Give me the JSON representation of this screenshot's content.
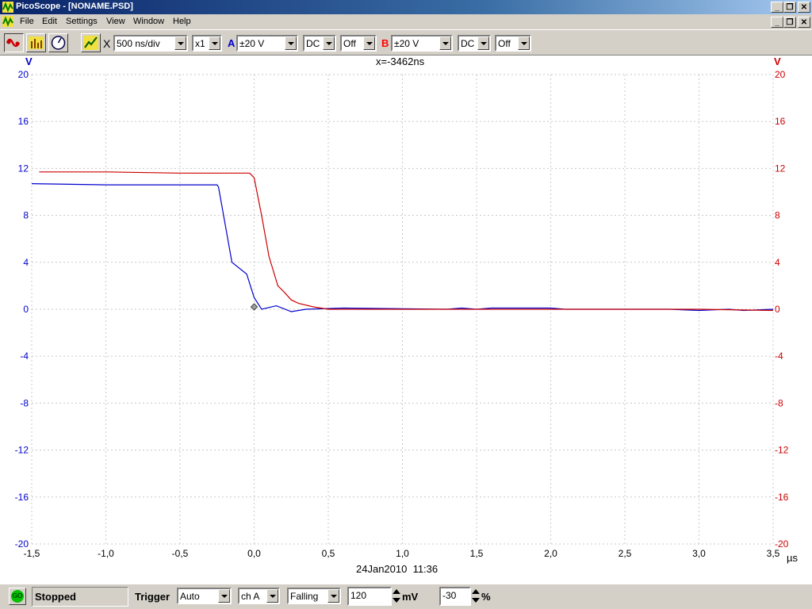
{
  "window": {
    "title": "PicoScope - [NONAME.PSD]"
  },
  "menu": [
    "File",
    "Edit",
    "Settings",
    "View",
    "Window",
    "Help"
  ],
  "toolbar": {
    "x_symbol": "X",
    "timebase": "500 ns/div",
    "zoom": "x1",
    "channel_a": {
      "label": "A",
      "range": "±20 V",
      "coupling": "DC",
      "extra": "Off",
      "color": "#0000cc"
    },
    "channel_b": {
      "label": "B",
      "range": "±20 V",
      "coupling": "DC",
      "extra": "Off",
      "color": "#ff0000"
    }
  },
  "plot": {
    "cursor_readout": "x=-3462ns",
    "y_unit_left": "V",
    "y_unit_right": "V",
    "x_unit": "µs",
    "timestamp": "24Jan2010  11:36",
    "x_ticks": [
      "-1,5",
      "-1,0",
      "-0,5",
      "0,0",
      "0,5",
      "1,0",
      "1,5",
      "2,0",
      "2,5",
      "3,0",
      "3,5"
    ],
    "y_ticks": [
      "20",
      "16",
      "12",
      "8",
      "4",
      "0",
      "-4",
      "-8",
      "-12",
      "-16",
      "-20"
    ]
  },
  "chart_data": {
    "type": "line",
    "xlim": [
      -1.5,
      3.5
    ],
    "ylim": [
      -20,
      20
    ],
    "grid": true,
    "trigger_marker": {
      "x": 0.0,
      "y": 0.2
    },
    "series": [
      {
        "channel": "A",
        "color": "#0000cc",
        "points": [
          [
            -1.5,
            10.7
          ],
          [
            -1.0,
            10.6
          ],
          [
            -0.5,
            10.6
          ],
          [
            -0.25,
            10.6
          ],
          [
            -0.24,
            10.4
          ],
          [
            -0.15,
            4.0
          ],
          [
            -0.05,
            3.0
          ],
          [
            0.0,
            1.0
          ],
          [
            0.05,
            0.0
          ],
          [
            0.15,
            0.3
          ],
          [
            0.25,
            -0.2
          ],
          [
            0.35,
            0.0
          ],
          [
            0.6,
            0.1
          ],
          [
            1.3,
            0.0
          ],
          [
            1.4,
            0.1
          ],
          [
            1.5,
            0.0
          ],
          [
            1.6,
            0.1
          ],
          [
            2.0,
            0.1
          ],
          [
            2.1,
            0.0
          ],
          [
            2.8,
            0.0
          ],
          [
            3.0,
            -0.1
          ],
          [
            3.2,
            0.0
          ],
          [
            3.3,
            -0.1
          ],
          [
            3.5,
            0.0
          ]
        ]
      },
      {
        "channel": "B",
        "color": "#cc0000",
        "points": [
          [
            -1.45,
            11.7
          ],
          [
            -1.0,
            11.7
          ],
          [
            -0.5,
            11.6
          ],
          [
            -0.03,
            11.6
          ],
          [
            0.0,
            11.2
          ],
          [
            0.05,
            8.0
          ],
          [
            0.1,
            4.5
          ],
          [
            0.16,
            2.0
          ],
          [
            0.2,
            1.5
          ],
          [
            0.25,
            0.8
          ],
          [
            0.3,
            0.5
          ],
          [
            0.4,
            0.2
          ],
          [
            0.5,
            0.0
          ],
          [
            1.0,
            0.0
          ],
          [
            2.0,
            0.0
          ],
          [
            3.0,
            0.0
          ],
          [
            3.5,
            -0.1
          ]
        ]
      }
    ]
  },
  "status": {
    "go_label": "GO",
    "state": "Stopped",
    "trigger_label": "Trigger",
    "trigger_mode": "Auto",
    "trigger_channel": "ch A",
    "trigger_edge": "Falling",
    "threshold": "120",
    "threshold_unit": "mV",
    "pretrigger": "-30",
    "pretrigger_unit": "%"
  }
}
